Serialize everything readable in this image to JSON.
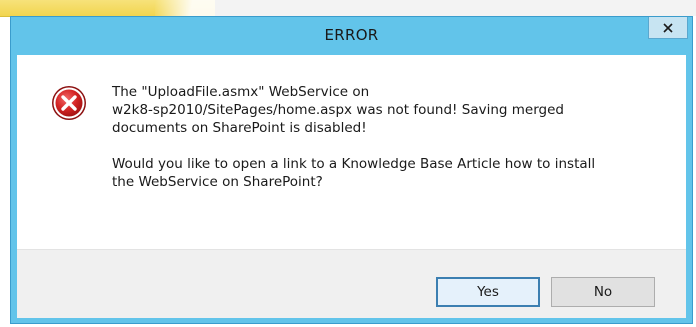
{
  "window": {
    "title": "ERROR",
    "close_glyph": "x"
  },
  "message": {
    "line1": "The \"UploadFile.asmx\" WebService on",
    "line2": "w2k8-sp2010/SitePages/home.aspx was not found! Saving merged",
    "line3": "documents on SharePoint is disabled!",
    "question_line1": "Would you like to open a link to a Knowledge Base Article how to install",
    "question_line2": "the WebService on SharePoint?"
  },
  "buttons": {
    "yes_label": "Yes",
    "no_label": "No"
  },
  "icons": {
    "error": "error-x-circle-icon",
    "close": "close-icon"
  },
  "colors": {
    "titlebar": "#62c4ea",
    "error_red": "#d42424",
    "default_button_border": "#3c7fb1"
  }
}
